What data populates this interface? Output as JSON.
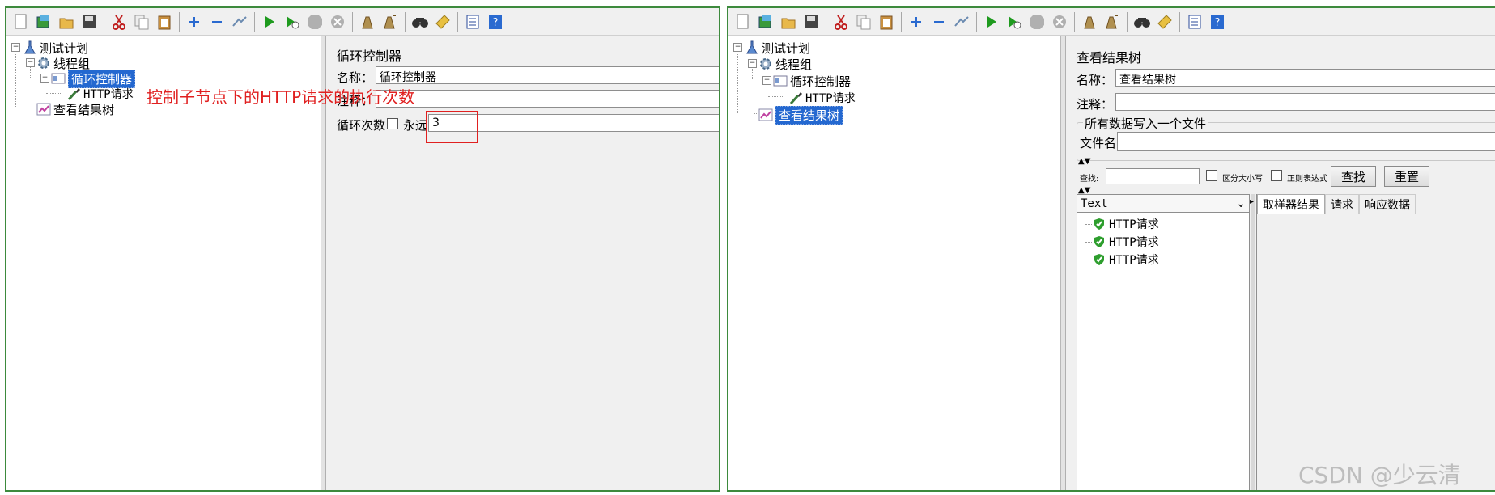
{
  "left_panel": {
    "tree": {
      "test_plan": "测试计划",
      "thread_group": "线程组",
      "loop_controller": "循环控制器",
      "http_request": "HTTP请求",
      "view_results_tree": "查看结果树"
    },
    "editor": {
      "title": "循环控制器",
      "name_label": "名称：",
      "name_value": "循环控制器",
      "comment_label": "注释：",
      "comment_value": "",
      "loop_count_label": "循环次数",
      "forever_label": "永远",
      "forever_checked": false,
      "loop_count_value": "3"
    },
    "annotation": {
      "text": "控制子节点下的HTTP请求的执行次数",
      "color": "#e02020"
    }
  },
  "right_panel": {
    "tree": {
      "test_plan": "测试计划",
      "thread_group": "线程组",
      "loop_controller": "循环控制器",
      "http_request": "HTTP请求",
      "view_results_tree": "查看结果树"
    },
    "editor": {
      "title": "查看结果树",
      "name_label": "名称：",
      "name_value": "查看结果树",
      "comment_label": "注释：",
      "comment_value": "",
      "file_group_title": "所有数据写入一个文件",
      "filename_label": "文件名",
      "filename_value": "",
      "search_label": "查找:",
      "search_value": "",
      "case_sensitive_label": "区分大小写",
      "regex_label": "正则表达式",
      "find_button": "查找",
      "reset_button": "重置",
      "renderer_selected": "Text",
      "results": [
        "HTTP请求",
        "HTTP请求",
        "HTTP请求"
      ],
      "tabs": [
        "取样器结果",
        "请求",
        "响应数据"
      ]
    }
  },
  "watermark": "CSDN @少云清",
  "colors": {
    "panel_border": "#3d8a3d",
    "selection": "#2468d0",
    "success": "#2e9e2e"
  }
}
